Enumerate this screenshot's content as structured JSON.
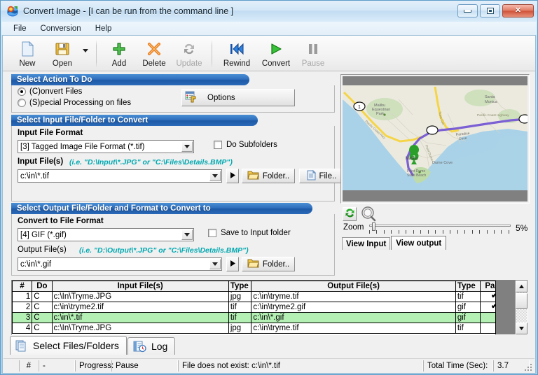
{
  "window": {
    "title": "Convert Image - [I can be run from the command line ]",
    "icon": "app-icon",
    "minimize": "minimize",
    "maximize": "maximize",
    "close": "close"
  },
  "menu": [
    {
      "label": "File"
    },
    {
      "label": "Conversion"
    },
    {
      "label": "Help"
    }
  ],
  "toolbar": [
    {
      "label": "New",
      "icon": "new-document-icon",
      "disabled": false
    },
    {
      "label": "Open",
      "icon": "open-folder-icon",
      "disabled": false
    },
    {
      "label": "Add",
      "icon": "plus-icon",
      "disabled": false
    },
    {
      "label": "Delete",
      "icon": "delete-x-icon",
      "disabled": false
    },
    {
      "label": "Update",
      "icon": "refresh-icon",
      "disabled": true
    },
    {
      "label": "Rewind",
      "icon": "rewind-icon",
      "disabled": false
    },
    {
      "label": "Convert",
      "icon": "play-icon",
      "disabled": false
    },
    {
      "label": "Pause",
      "icon": "pause-icon",
      "disabled": true
    }
  ],
  "action_group": {
    "header": "Select Action To Do",
    "radio_convert": "(C)onvert Files",
    "radio_special": "(S)pecial Processing on files",
    "selected": "convert",
    "options_button": "Options"
  },
  "input_group": {
    "header": "Select Input File/Folder to Convert",
    "format_label": "Input File Format",
    "format_value": "[3] Tagged Image File Format (*.tif)",
    "subfolders_label": "Do Subfolders",
    "subfolders_checked": false,
    "files_label": "Input File(s)",
    "files_hint": "(i.e. \"D:\\Input\\*.JPG\"  or \"C:\\Files\\Details.BMP\")",
    "files_value": "c:\\in\\*.tif",
    "go_button": "go-arrow",
    "folder_button": "Folder..",
    "file_button": "File.."
  },
  "output_group": {
    "header": "Select Output File/Folder and Format to Convert to",
    "format_label": "Convert to File Format",
    "format_value": "[4] GIF (*.gif)",
    "save_to_input_label": "Save to Input folder",
    "save_to_input_checked": false,
    "files_label": "Output File(s)",
    "files_hint": "(i.e. \"D:\\Output\\*.JPG\"  or \"C:\\Files\\Details.BMP\")",
    "files_value": "c:\\in\\*.gif",
    "go_button": "go-arrow",
    "folder_button": "Folder.."
  },
  "preview": {
    "refresh_icon": "refresh-green-icon",
    "magnify_icon": "magnifier-icon",
    "zoom_label": "Zoom",
    "zoom_value": "5%",
    "zoom_percent": 5,
    "tab_input": "View Input",
    "tab_output": "View output",
    "active_tab": "View output",
    "map_labels": [
      "Malibu Equestrian Park",
      "Santa Monica",
      "Pacific Coast Highway",
      "Paradise Cove",
      "Malibu",
      "Dume Cove",
      "Point Dume State Beach"
    ],
    "map_marker": "a"
  },
  "file_table": {
    "columns": [
      "#",
      "Do",
      "Input File(s)",
      "Type",
      "Output File(s)",
      "Type",
      "Pass"
    ],
    "rows": [
      {
        "num": "1",
        "do": "C",
        "input": "c:\\In\\Tryme.JPG",
        "intype": "jpg",
        "output": "c:\\in\\tryme.tif",
        "outtype": "tif",
        "pass": "✔",
        "highlight": false
      },
      {
        "num": "2",
        "do": "C",
        "input": "c:\\in\\tryme2.tif",
        "intype": "tif",
        "output": "c:\\in\\tryme2.gif",
        "outtype": "gif",
        "pass": "✔",
        "highlight": false
      },
      {
        "num": "3",
        "do": "C",
        "input": "c:\\in\\*.tif",
        "intype": "tif",
        "output": "c:\\in\\*.gif",
        "outtype": "gif",
        "pass": "",
        "highlight": true
      },
      {
        "num": "4",
        "do": "C",
        "input": "c:\\In\\Tryme.JPG",
        "intype": "jpg",
        "output": "c:\\in\\tryme.tif",
        "outtype": "tif",
        "pass": "",
        "highlight": false
      }
    ]
  },
  "tabs": [
    {
      "label": "Select Files/Folders",
      "icon": "copy-pages-icon",
      "active": true
    },
    {
      "label": "Log",
      "icon": "log-clock-icon",
      "active": false
    }
  ],
  "statusbar": {
    "hash_label": "#",
    "hash_value": "-",
    "progress_label": "Progress:",
    "progress_value": "Pause",
    "message": "File does not exist: c:\\in\\*.tif",
    "total_time_label": "Total Time (Sec):",
    "total_time_value": "3.7"
  },
  "colors": {
    "group_header": "#2f6fbd",
    "hint_text": "#00a8b0",
    "highlight_row": "#b4f0b4",
    "pass_tick": "#0a8f0a",
    "close_button": "#cf5238"
  }
}
